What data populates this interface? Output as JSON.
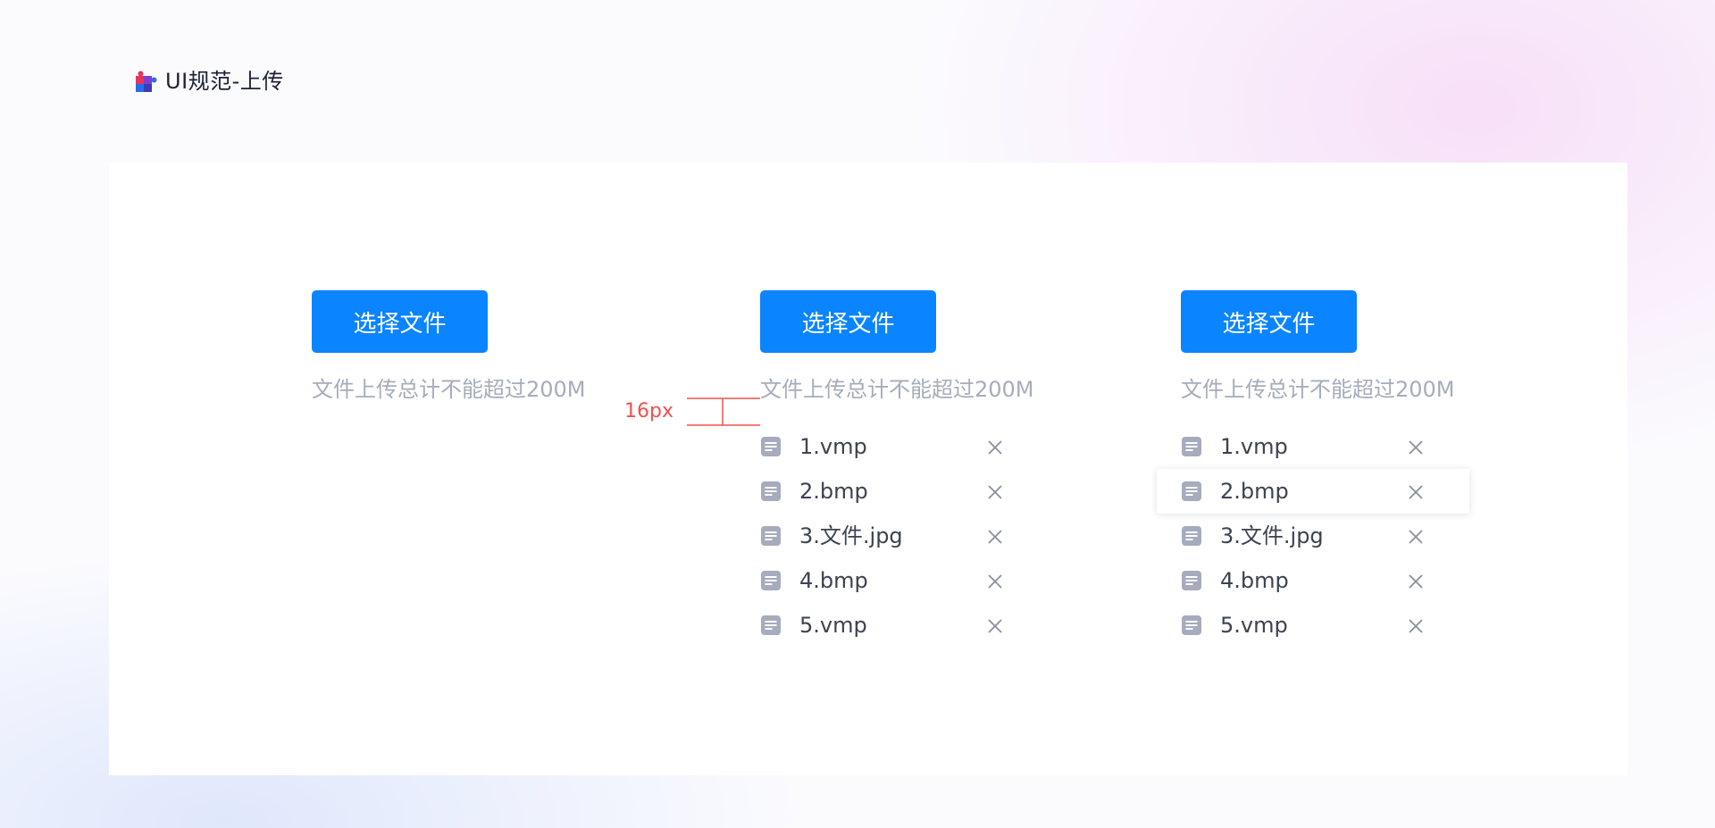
{
  "header": {
    "title": "UI规范-上传",
    "logo_icon": "puzzle-icon"
  },
  "colors": {
    "primary": "#0a84ff",
    "hint": "#a6acba",
    "file_text": "#3d4250",
    "file_icon": "#a6abbd",
    "annotation": "#f0524c"
  },
  "annotation": {
    "spacing_label": "16px"
  },
  "uploaders": [
    {
      "state": "default",
      "button_label": "选择文件",
      "hint": "文件上传总计不能超过200M",
      "files": []
    },
    {
      "state": "with-files",
      "button_label": "选择文件",
      "hint": "文件上传总计不能超过200M",
      "files": [
        "1.vmp",
        "2.bmp",
        "3.文件.jpg",
        "4.bmp",
        "5.vmp"
      ]
    },
    {
      "state": "hover",
      "button_label": "选择文件",
      "hint": "文件上传总计不能超过200M",
      "hover_index": 1,
      "files": [
        "1.vmp",
        "2.bmp",
        "3.文件.jpg",
        "4.bmp",
        "5.vmp"
      ]
    }
  ]
}
